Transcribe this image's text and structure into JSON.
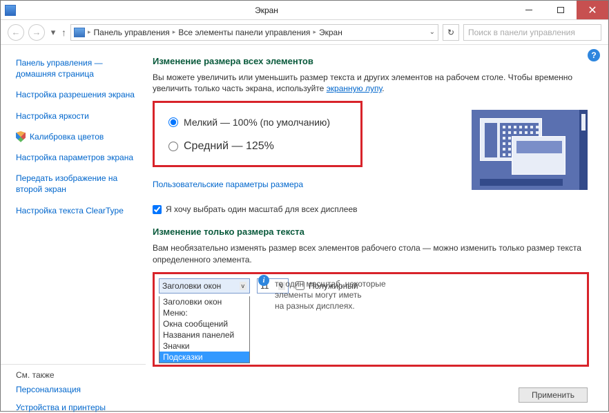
{
  "window": {
    "title": "Экран"
  },
  "nav": {
    "crumb1": "Панель управления",
    "crumb2": "Все элементы панели управления",
    "crumb3": "Экран",
    "search_placeholder": "Поиск в панели управления"
  },
  "sidebar": {
    "home1": "Панель управления —",
    "home2": "домашняя страница",
    "l_res": "Настройка разрешения экрана",
    "l_bright": "Настройка яркости",
    "l_calib": "Калибровка цветов",
    "l_disp": "Настройка параметров экрана",
    "l_proj1": "Передать изображение на",
    "l_proj2": "второй экран",
    "l_clear": "Настройка текста ClearType",
    "seealso": "См. также",
    "l_pers": "Персонализация",
    "l_dev": "Устройства и принтеры"
  },
  "main": {
    "h1": "Изменение размера всех элементов",
    "desc1": "Вы можете увеличить или уменьшить размер текста и других элементов на рабочем столе. Чтобы временно увеличить только часть экрана, используйте ",
    "magnifier": "экранную лупу",
    "r1": "Мелкий — 100% (по умолчанию)",
    "r2": "Средний — 125%",
    "custom": "Пользовательские параметры размера",
    "chk": "Я хочу выбрать один масштаб для всех дисплеев",
    "h2": "Изменение только размера текста",
    "desc2": "Вам необязательно изменять размер всех элементов рабочего стола — можно изменить только размер текста определенного элемента.",
    "sel_val": "Заголовки окон",
    "size_val": "11",
    "bold": "Полужирный",
    "opts": [
      "Заголовки окон",
      "Меню:",
      "Окна сообщений",
      "Названия панелей",
      "Значки",
      "Подсказки"
    ],
    "note1": "те один масштаб, некоторые элементы могут иметь",
    "note2": "на разных дисплеях.",
    "apply": "Применить"
  }
}
